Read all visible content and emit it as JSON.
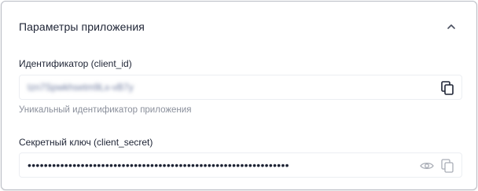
{
  "section": {
    "title": "Параметры приложения",
    "collapse_icon": "chevron-up-icon"
  },
  "client_id": {
    "label": "Идентификатор (client_id)",
    "value": "tzn7Spwkhsetm9Lx-vB7y",
    "hint": "Уникальный идентификатор приложения",
    "copy_icon": "copy-icon"
  },
  "client_secret": {
    "label": "Секретный ключ (client_secret)",
    "value": "••••••••••••••••••••••••••••••••••••••••••••••••••••••••••••••••",
    "show_icon": "eye-icon",
    "copy_icon": "copy-icon"
  },
  "colors": {
    "text": "#1e2435",
    "muted": "#8a8f9b",
    "border": "#b9bcc4",
    "field_border": "#eceef2",
    "icon_active": "#1e2435",
    "icon_disabled": "#a9adb6"
  }
}
